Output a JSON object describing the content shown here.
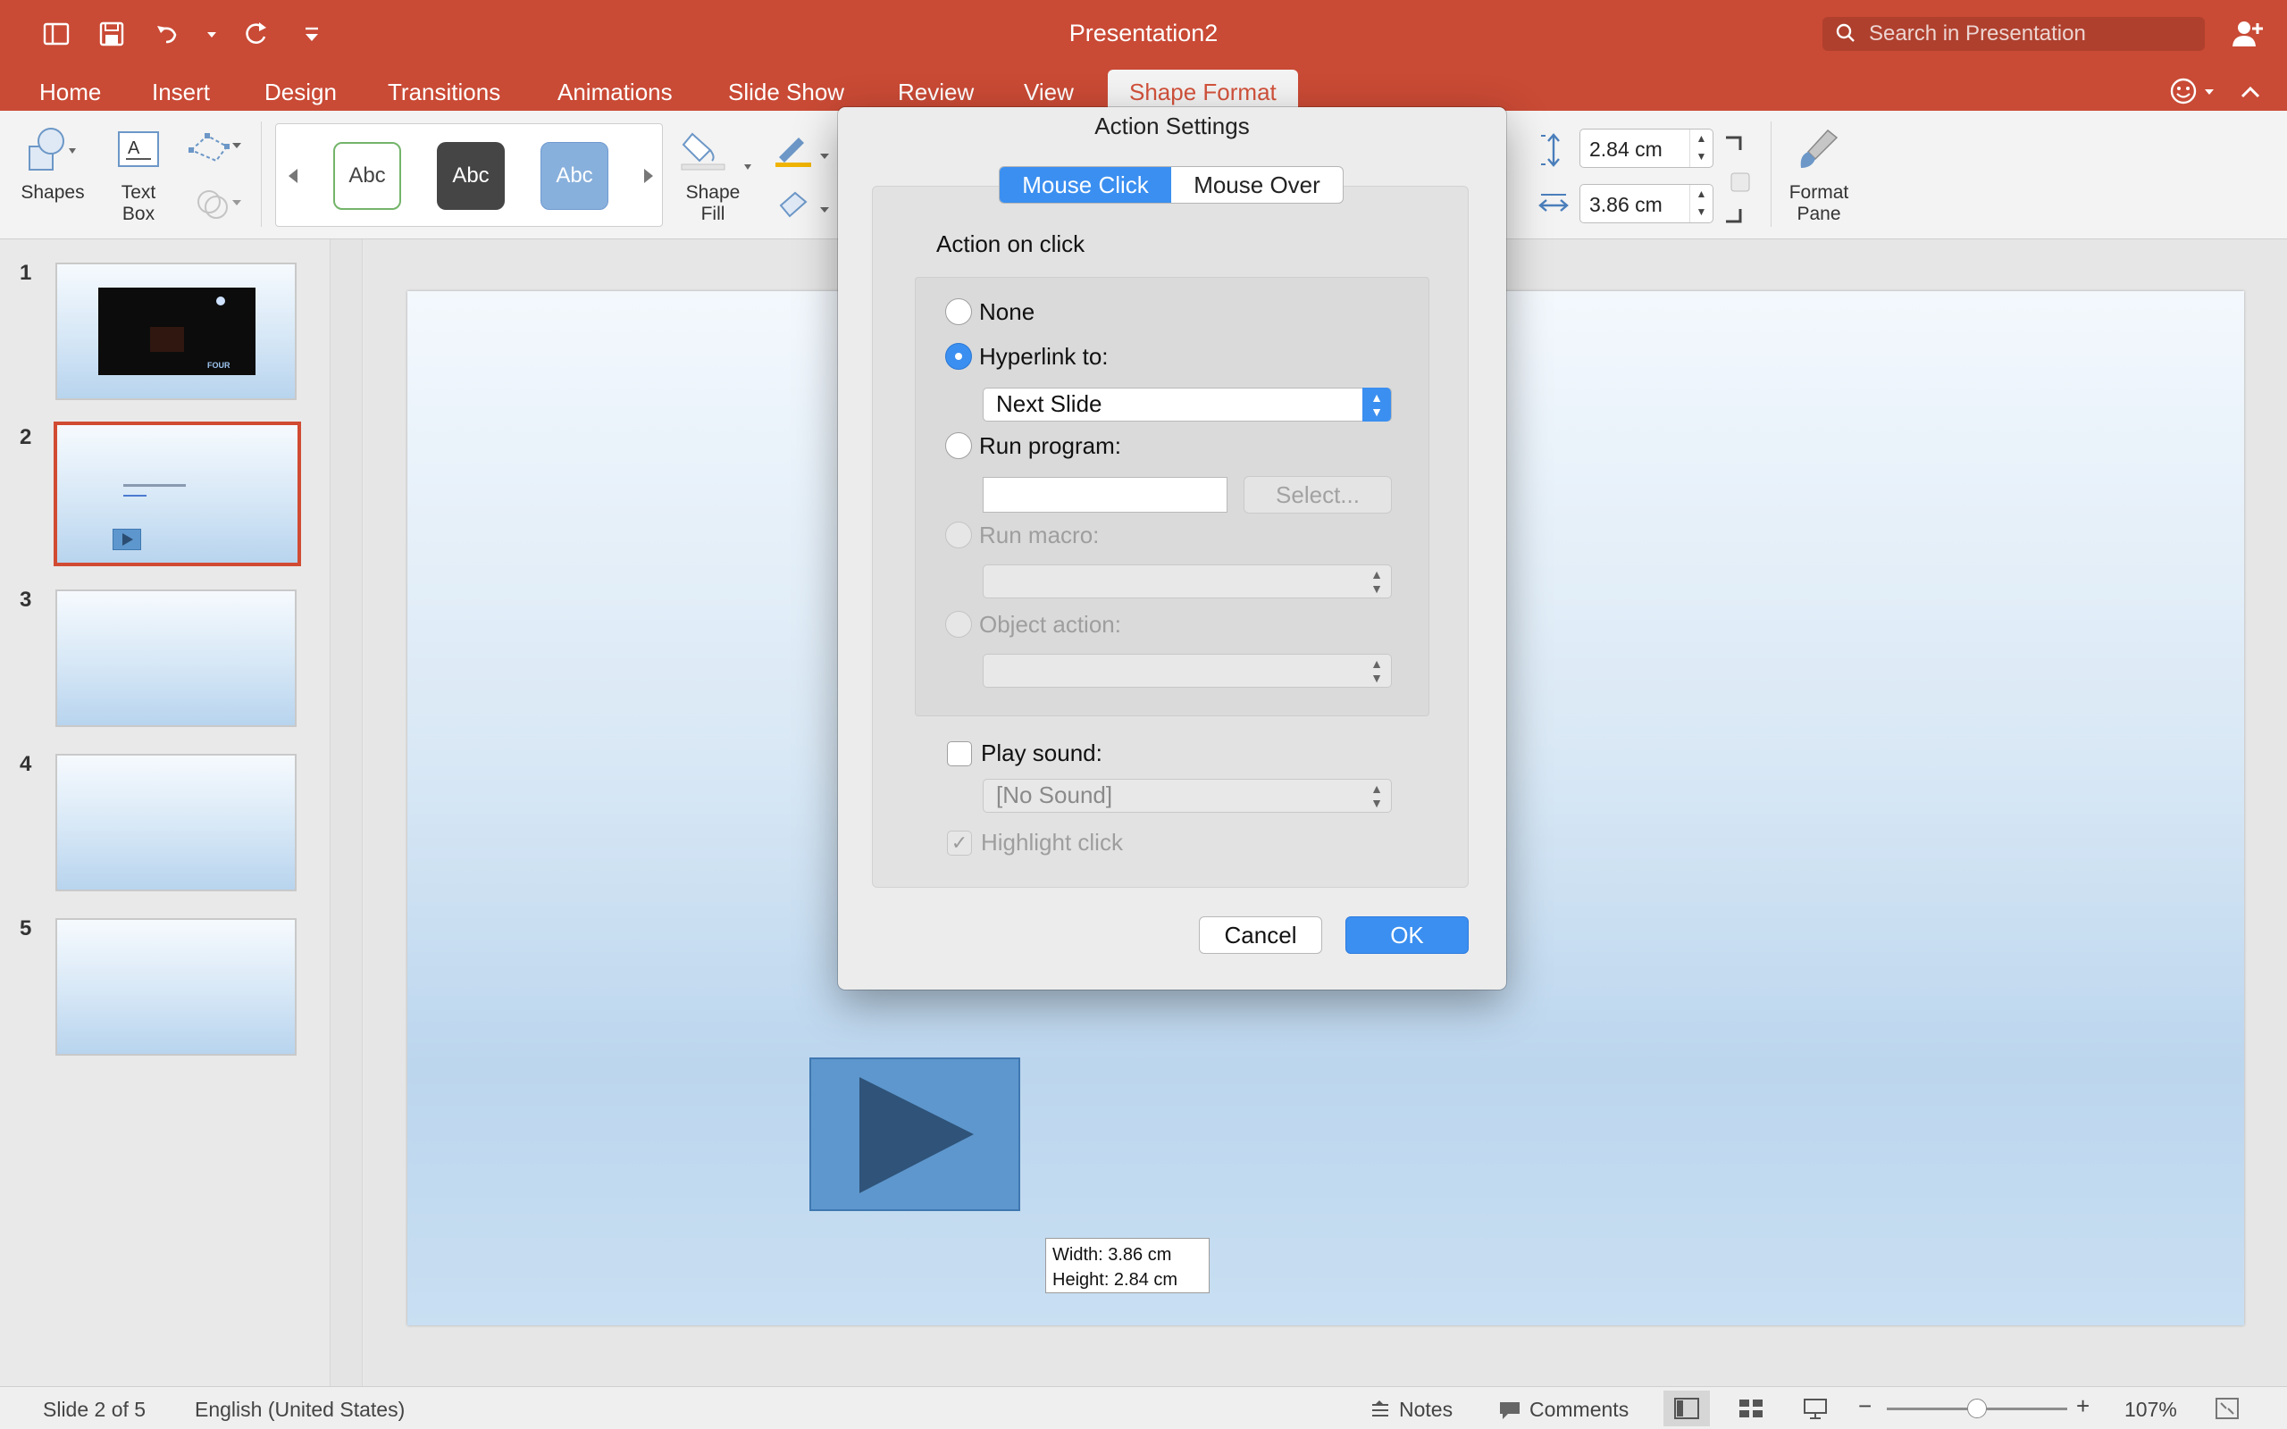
{
  "app": {
    "title": "Presentation2",
    "search_placeholder": "Search in Presentation",
    "accent_color": "#c94a35"
  },
  "quick_access": {
    "icons": [
      "sidebar-toggle-icon",
      "save-icon",
      "undo-icon",
      "redo-icon",
      "customize-icon"
    ]
  },
  "tabs": [
    "Home",
    "Insert",
    "Design",
    "Transitions",
    "Animations",
    "Slide Show",
    "Review",
    "View",
    "Shape Format"
  ],
  "active_tab": "Shape Format",
  "ribbon": {
    "shapes_label": "Shapes",
    "textbox_label_1": "Text",
    "textbox_label_2": "Box",
    "style_samples": [
      "Abc",
      "Abc",
      "Abc"
    ],
    "shape_fill_label_1": "Shape",
    "shape_fill_label_2": "Fill",
    "height_value": "2.84 cm",
    "width_value": "3.86 cm",
    "format_pane_label_1": "Format",
    "format_pane_label_2": "Pane"
  },
  "slides": {
    "numbers": [
      "1",
      "2",
      "3",
      "4",
      "5"
    ],
    "selected": "2",
    "slide1_text": "FOUR"
  },
  "dialog": {
    "title": "Action Settings",
    "segments": [
      "Mouse Click",
      "Mouse Over"
    ],
    "active_segment": "Mouse Click",
    "section_label": "Action on click",
    "options": {
      "none": "None",
      "hyperlink": "Hyperlink to:",
      "hyperlink_value": "Next Slide",
      "run_program": "Run program:",
      "select_button": "Select...",
      "run_macro": "Run macro:",
      "object_action": "Object action:"
    },
    "selected_option": "Hyperlink to:",
    "play_sound_label": "Play sound:",
    "sound_value": "[No Sound]",
    "highlight_label": "Highlight click",
    "cancel_label": "Cancel",
    "ok_label": "OK"
  },
  "tooltip": {
    "width": "Width: 3.86 cm",
    "height": "Height: 2.84 cm"
  },
  "status": {
    "slide_count": "Slide 2 of 5",
    "language": "English (United States)",
    "notes_label": "Notes",
    "comments_label": "Comments",
    "zoom": "107%"
  }
}
